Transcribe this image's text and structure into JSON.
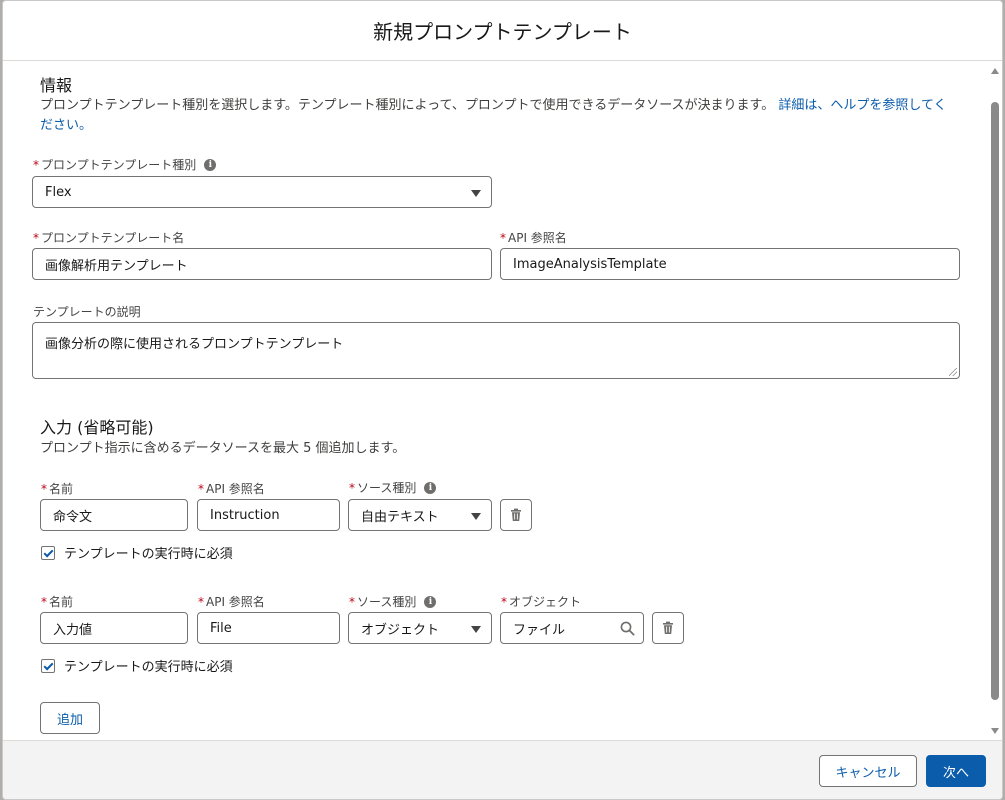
{
  "modal": {
    "title": "新規プロンプトテンプレート"
  },
  "info_section": {
    "title": "情報",
    "help_text": "プロンプトテンプレート種別を選択します。テンプレート種別によって、プロンプトで使用できるデータソースが決まります。",
    "help_link": "詳細は、ヘルプを参照してください。"
  },
  "template_type": {
    "label": "プロンプトテンプレート種別",
    "value": "Flex"
  },
  "template_name": {
    "label": "プロンプトテンプレート名",
    "value": "画像解析用テンプレート"
  },
  "api_name": {
    "label": "API 参照名",
    "value": "ImageAnalysisTemplate"
  },
  "description": {
    "label": "テンプレートの説明",
    "value": "画像分析の際に使用されるプロンプトテンプレート"
  },
  "inputs_section": {
    "title": "入力 (省略可能)",
    "help_text": "プロンプト指示に含めるデータソースを最大 5 個追加します。",
    "labels": {
      "name": "名前",
      "api_name": "API 参照名",
      "source_type": "ソース種別",
      "object": "オブジェクト",
      "required": "テンプレートの実行時に必須"
    },
    "inputs": [
      {
        "name": "命令文",
        "api_name": "Instruction",
        "source_type": "自由テキスト",
        "required": true
      },
      {
        "name": "入力値",
        "api_name": "File",
        "source_type": "オブジェクト",
        "object": "ファイル",
        "required": true
      }
    ],
    "add_label": "追加"
  },
  "footer": {
    "cancel_label": "キャンセル",
    "next_label": "次へ"
  },
  "colors": {
    "brand": "#0b5cab",
    "required": "#ba0517",
    "border": "#747474"
  }
}
